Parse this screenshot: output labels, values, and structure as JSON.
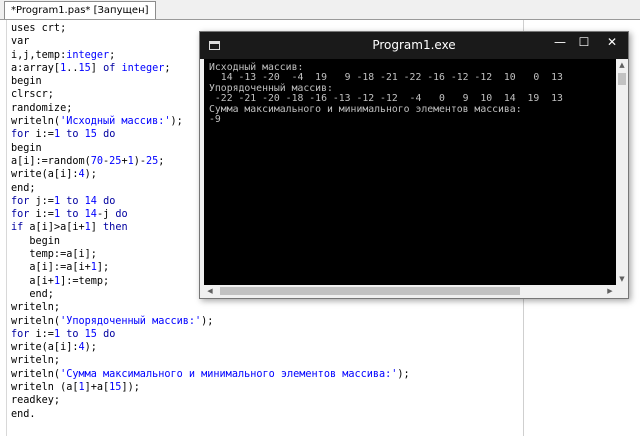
{
  "ide": {
    "tab_title": "*Program1.pas* [Запущен]",
    "code_lines": [
      "uses crt;",
      "var",
      "i,j,temp:integer;",
      "a:array[1..15] of integer;",
      "begin",
      "clrscr;",
      "randomize;",
      "writeln('Исходный массив:');",
      "for i:=1 to 15 do",
      "begin",
      "a[i]:=random(70-25+1)-25;",
      "write(a[i]:4);",
      "end;",
      "for j:=1 to 14 do",
      "for i:=1 to 14-j do",
      "if a[i]>a[i+1] then",
      "   begin",
      "   temp:=a[i];",
      "   a[i]:=a[i+1];",
      "   a[i+1]:=temp;",
      "   end;",
      "writeln;",
      "writeln('Упорядоченный массив:');",
      "for i:=1 to 15 do",
      "write(a[i]:4);",
      "writeln;",
      "writeln('Сумма максимального и минимального элементов массива:');",
      "writeln (a[1]+a[15]);",
      "readkey;",
      "end."
    ]
  },
  "console": {
    "title": "Program1.exe",
    "buttons": {
      "minimize": "—",
      "maximize": "☐",
      "close": "✕"
    },
    "lines": [
      "Исходный массив:",
      "  14 -13 -20  -4  19   9 -18 -21 -22 -16 -12 -12  10   0  13",
      "Упорядоченный массив:",
      " -22 -21 -20 -18 -16 -13 -12 -12  -4   0   9  10  14  19  13",
      "Сумма максимального и минимального элементов массива:",
      "-9"
    ],
    "scroll_arrows": {
      "up": "▲",
      "down": "▼",
      "left": "◀",
      "right": "▶"
    }
  },
  "colors": {
    "keyword": "#0000a0",
    "literal": "#0000ff",
    "console_bg": "#000000",
    "console_fg": "#c0c0c0",
    "titlebar": "#1a1a1a"
  },
  "icons": [
    "console-app-icon",
    "minimize-icon",
    "maximize-icon",
    "close-icon"
  ]
}
